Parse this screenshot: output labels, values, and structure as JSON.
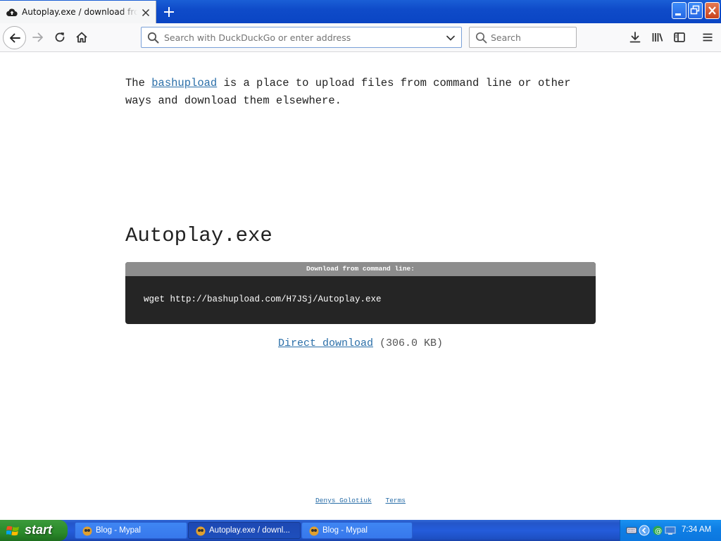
{
  "browser": {
    "tab": {
      "title": "Autoplay.exe / download from bashupload.com",
      "icon": "cloud-upload-icon"
    },
    "url_bar": {
      "value": "",
      "placeholder": "Search with DuckDuckGo or enter address"
    },
    "search_bar": {
      "placeholder": "Search"
    }
  },
  "page": {
    "intro_prefix": "The ",
    "intro_link": "bashupload",
    "intro_suffix": " is a place to upload files from command line or other ways and download them elsewhere.",
    "file_name": "Autoplay.exe",
    "command_header": "Download from command line:",
    "command": "wget http://bashupload.com/H7JSj/Autoplay.exe",
    "direct_download_label": "Direct download",
    "file_size": "(306.0 KB)",
    "footer_links": [
      "Denys Golotiuk",
      "Terms"
    ]
  },
  "taskbar": {
    "start_label": "start",
    "tasks": [
      {
        "label": "Blog - Mypal",
        "active": false
      },
      {
        "label": "Autoplay.exe / downl...",
        "active": true
      },
      {
        "label": "Blog - Mypal",
        "active": false
      }
    ],
    "clock": "7:34 AM"
  },
  "colors": {
    "title_bar": "#0f4bc9",
    "link": "#2a6ea8",
    "command_box": "#252525",
    "command_header": "#8d8d8d",
    "taskbar": "#245cdb",
    "start_button": "#2f8f2f"
  }
}
